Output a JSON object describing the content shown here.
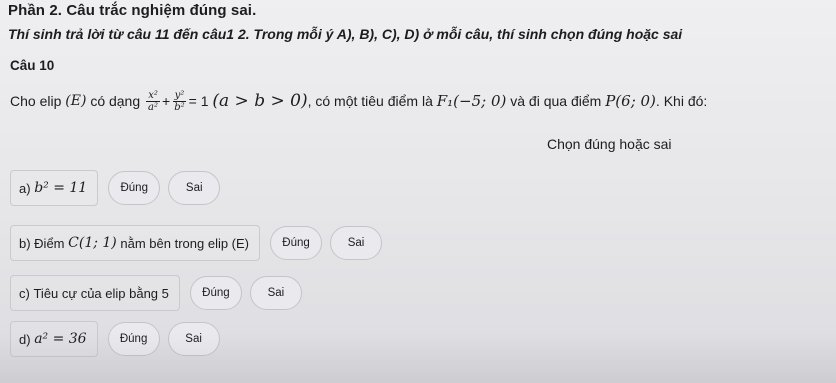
{
  "section_title": "Phần 2. Câu trắc nghiệm đúng sai.",
  "instruction": "Thí sinh trả lời từ câu 11 đến câu1 2. Trong mỗi ý A), B), C), D) ở mỗi câu, thí sinh chọn đúng hoặc sai",
  "question_label": "Câu 10",
  "stem": {
    "prefix": "Cho elip",
    "ellipse_name": "(E)",
    "form_text": "có dạng",
    "frac1_num": "x²",
    "frac1_den": "a²",
    "plus": "+",
    "frac2_num": "y²",
    "frac2_den": "b²",
    "equals": "= 1",
    "condition": "(a > b > 0)",
    "middle_text": ", có một tiêu điểm là",
    "focus": "F₁(−5; 0)",
    "passes_text": "và đi qua điểm",
    "point": "P(6; 0)",
    "suffix": ". Khi đó:"
  },
  "choose_label": "Chọn đúng hoặc sai",
  "options": [
    {
      "label": "a)",
      "math": "b² = 11",
      "text": "",
      "true_label": "Đúng",
      "false_label": "Sai"
    },
    {
      "label": "b) Điểm",
      "math": "C(1; 1)",
      "text": "nằm bên trong elip (E)",
      "true_label": "Đúng",
      "false_label": "Sai"
    },
    {
      "label": "c)",
      "math": "",
      "text": "Tiêu cự của elip bằng 5",
      "true_label": "Đúng",
      "false_label": "Sai"
    },
    {
      "label": "d)",
      "math": "a² = 36",
      "text": "",
      "true_label": "Đúng",
      "false_label": "Sai"
    }
  ]
}
